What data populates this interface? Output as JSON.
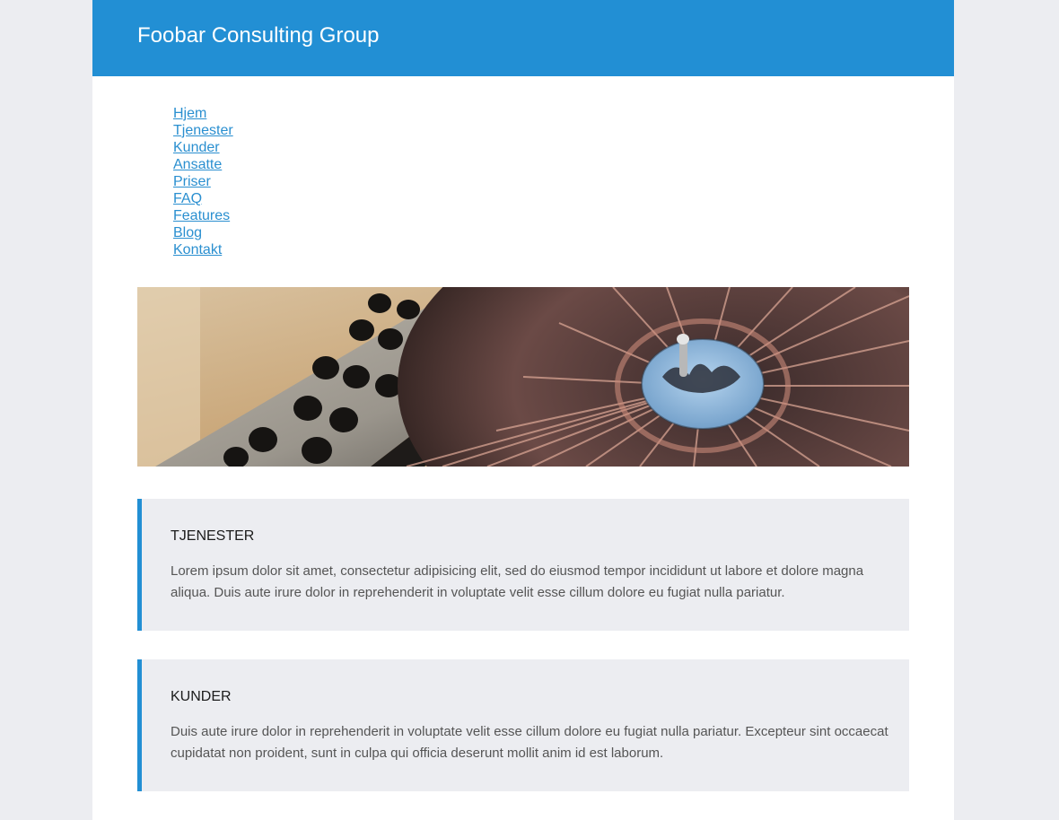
{
  "header": {
    "title": "Foobar Consulting Group"
  },
  "nav": {
    "items": [
      {
        "label": "Hjem"
      },
      {
        "label": "Tjenester"
      },
      {
        "label": "Kunder"
      },
      {
        "label": "Ansatte"
      },
      {
        "label": "Priser"
      },
      {
        "label": "FAQ"
      },
      {
        "label": "Features"
      },
      {
        "label": "Blog"
      },
      {
        "label": "Kontakt"
      }
    ]
  },
  "hero": {
    "image": "dj-mixer-turntable-photo"
  },
  "sections": [
    {
      "heading": "TJENESTER",
      "body": "Lorem ipsum dolor sit amet, consectetur adipisicing elit, sed do eiusmod tempor incididunt ut labore et dolore magna aliqua. Duis aute irure dolor in reprehenderit in voluptate velit esse cillum dolore eu fugiat nulla pariatur."
    },
    {
      "heading": "KUNDER",
      "body": "Duis aute irure dolor in reprehenderit in voluptate velit esse cillum dolore eu fugiat nulla pariatur. Excepteur sint occaecat cupidatat non proident, sunt in culpa qui officia deserunt mollit anim id est laborum."
    }
  ],
  "colors": {
    "brand": "#228FD4",
    "link": "#2A8FD0",
    "panel_bg": "#ECEDF1",
    "page_bg": "#ECEDF1"
  }
}
